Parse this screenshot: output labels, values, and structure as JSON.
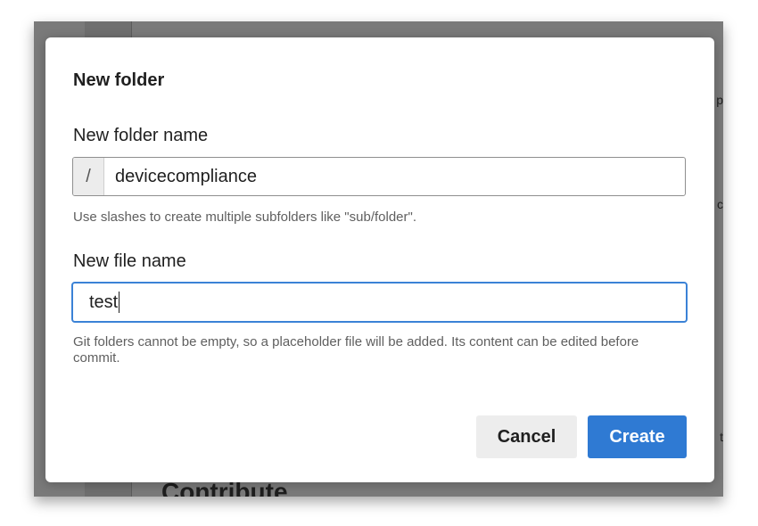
{
  "background": {
    "heading": "Contribute",
    "edge_chars": [
      "p",
      "c",
      "t"
    ]
  },
  "dialog": {
    "title": "New folder",
    "folder_field": {
      "label": "New folder name",
      "prefix": "/",
      "value": "devicecompliance",
      "help": "Use slashes to create multiple subfolders like \"sub/folder\"."
    },
    "file_field": {
      "label": "New file name",
      "value": "test",
      "help": "Git folders cannot be empty, so a placeholder file will be added. Its content can be edited before commit."
    },
    "buttons": {
      "cancel": "Cancel",
      "create": "Create"
    }
  },
  "colors": {
    "primary": "#2f7ad3",
    "focus_border": "#3b82d6",
    "overlay": "#7a7a7a"
  }
}
